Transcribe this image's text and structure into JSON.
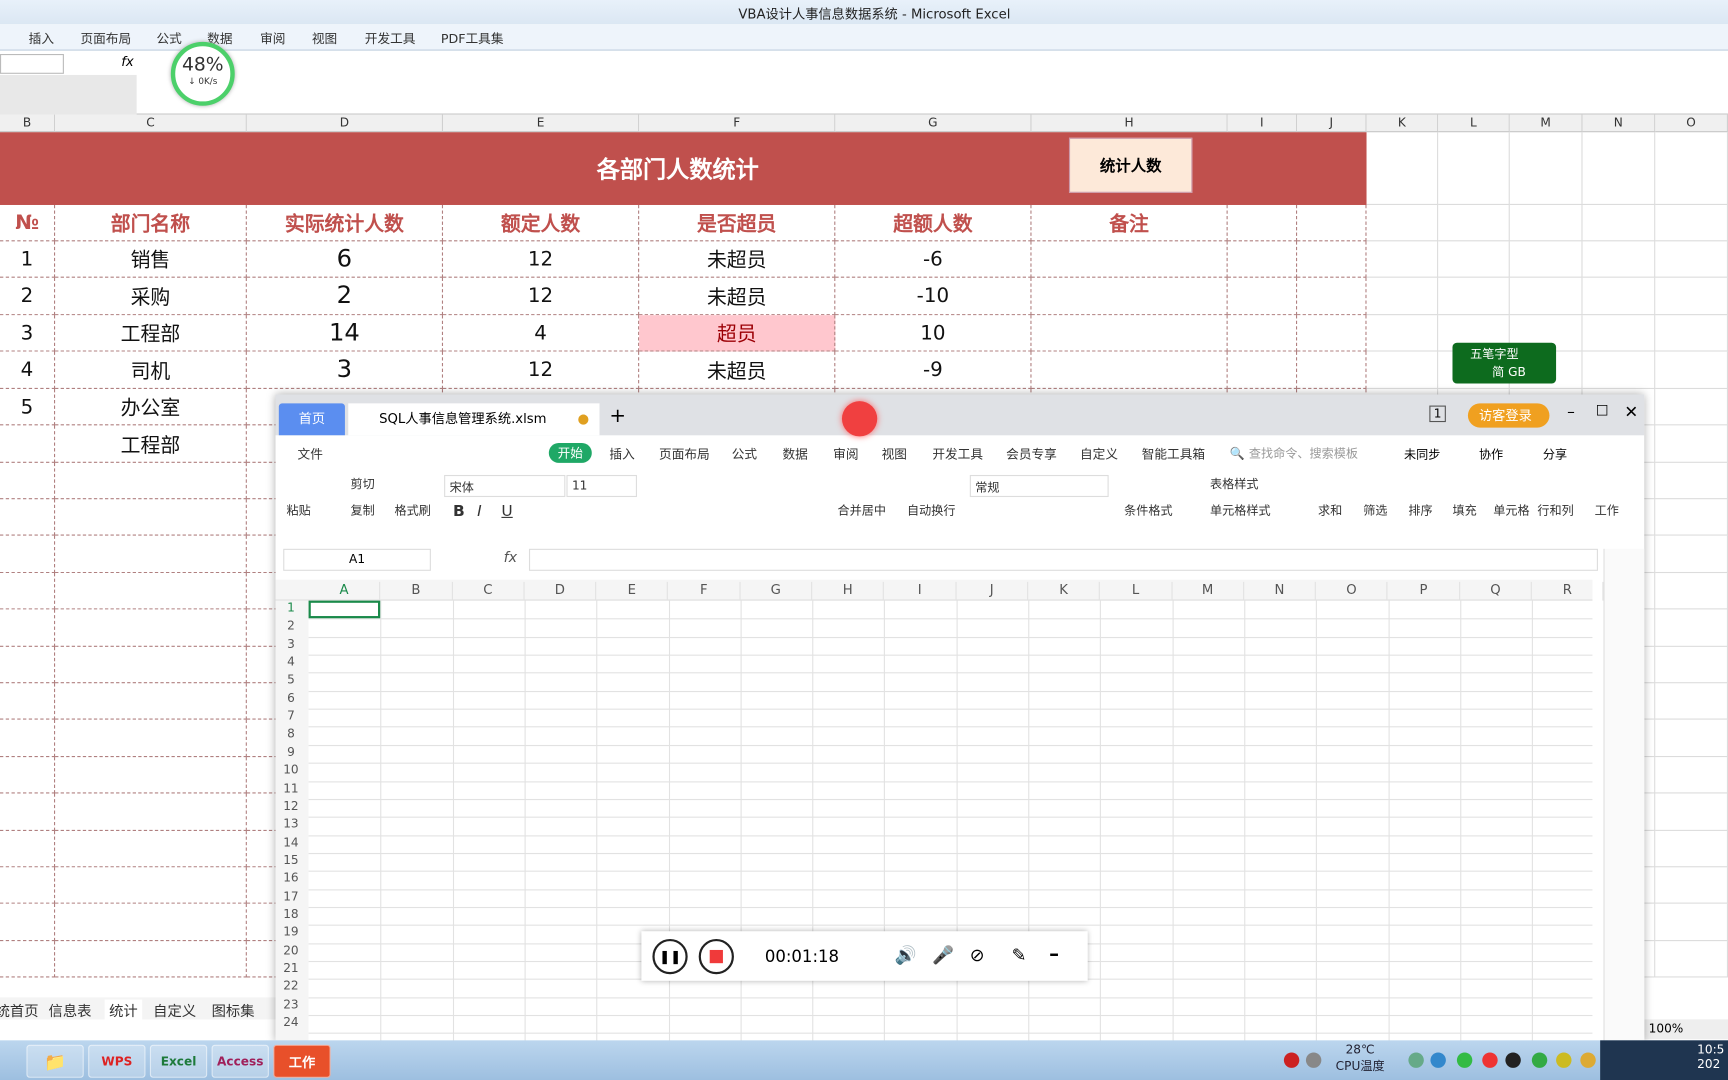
{
  "excel": {
    "title": "VBA设计人事信息数据系统  -  Microsoft Excel",
    "menu": [
      "插入",
      "页面布局",
      "公式",
      "数据",
      "审阅",
      "视图",
      "开发工具",
      "PDF工具集"
    ],
    "fx": "fx",
    "net_meter": {
      "percent": "48%",
      "speed": "↓ 0K/s",
      "value": 48
    },
    "columns": [
      "B",
      "C",
      "D",
      "E",
      "F",
      "G",
      "H",
      "I",
      "J",
      "K",
      "L",
      "M",
      "N",
      "O"
    ],
    "sheet_title": "各部门人数统计",
    "stat_button": "统计人数",
    "headers": [
      "№",
      "部门名称",
      "实际统计人数",
      "额定人数",
      "是否超员",
      "超额人数",
      "备注"
    ],
    "rows": [
      [
        "1",
        "销售",
        "6",
        "12",
        "未超员",
        "-6",
        ""
      ],
      [
        "2",
        "采购",
        "2",
        "12",
        "未超员",
        "-10",
        ""
      ],
      [
        "3",
        "工程部",
        "14",
        "4",
        "超员",
        "10",
        ""
      ],
      [
        "4",
        "司机",
        "3",
        "12",
        "未超员",
        "-9",
        ""
      ],
      [
        "5",
        "办公室",
        "",
        "",
        "",
        "",
        ""
      ],
      [
        "",
        "工程部",
        "",
        "",
        "",
        "",
        ""
      ]
    ],
    "sheet_tabs": [
      "统首页",
      "信息表",
      "统计",
      "自定义",
      "图标集"
    ],
    "zoom": "100%",
    "colors": {
      "title_bg": "#c0504d",
      "header_text": "#c0504d",
      "over_bg": "#ffc7ce",
      "button_bg": "#fde9d9"
    }
  },
  "ime": {
    "line1": "五笔字型",
    "line2": "简 GB"
  },
  "wps": {
    "home_tab": "首页",
    "doc_tab": "SQL人事信息管理系统.xlsm",
    "new_tab": "+",
    "page_count": "1",
    "login": "访客登录",
    "menu": [
      "文件",
      "开始",
      "插入",
      "页面布局",
      "公式",
      "数据",
      "审阅",
      "视图",
      "开发工具",
      "会员专享",
      "自定义",
      "智能工具箱"
    ],
    "search_placeholder": "查找命令、搜索模板",
    "sync": "未同步",
    "collab": "协作",
    "share": "分享",
    "ribbon": {
      "paste": "粘贴",
      "cut": "剪切",
      "copy": "复制",
      "format_painter": "格式刷",
      "font": "宋体",
      "size": "11",
      "merge": "合并居中",
      "wrap": "自动换行",
      "number_format": "常规",
      "cond_format": "条件格式",
      "table_style": "表格样式",
      "cell_style": "单元格样式",
      "sum": "求和",
      "filter": "筛选",
      "sort": "排序",
      "fill": "填充",
      "cell": "单元格",
      "rowcol": "行和列",
      "sheet": "工作"
    },
    "name_box": "A1",
    "fx": "fx",
    "columns": [
      "A",
      "B",
      "C",
      "D",
      "E",
      "F",
      "G",
      "H",
      "I",
      "J",
      "K",
      "L",
      "M",
      "N",
      "O",
      "P",
      "Q",
      "R"
    ],
    "rows": [
      "1",
      "2",
      "3",
      "4",
      "5",
      "6",
      "7",
      "8",
      "9",
      "10",
      "11",
      "12",
      "13",
      "14",
      "15",
      "16",
      "17",
      "18",
      "19",
      "20",
      "21",
      "22",
      "23",
      "24"
    ]
  },
  "recorder": {
    "time": "00:01:18"
  },
  "taskbar": {
    "apps": [
      "WPS",
      "Excel",
      "Access",
      "工作"
    ],
    "temp": "28℃",
    "temp_label": "CPU温度",
    "clock": "10:5",
    "date": "202"
  }
}
